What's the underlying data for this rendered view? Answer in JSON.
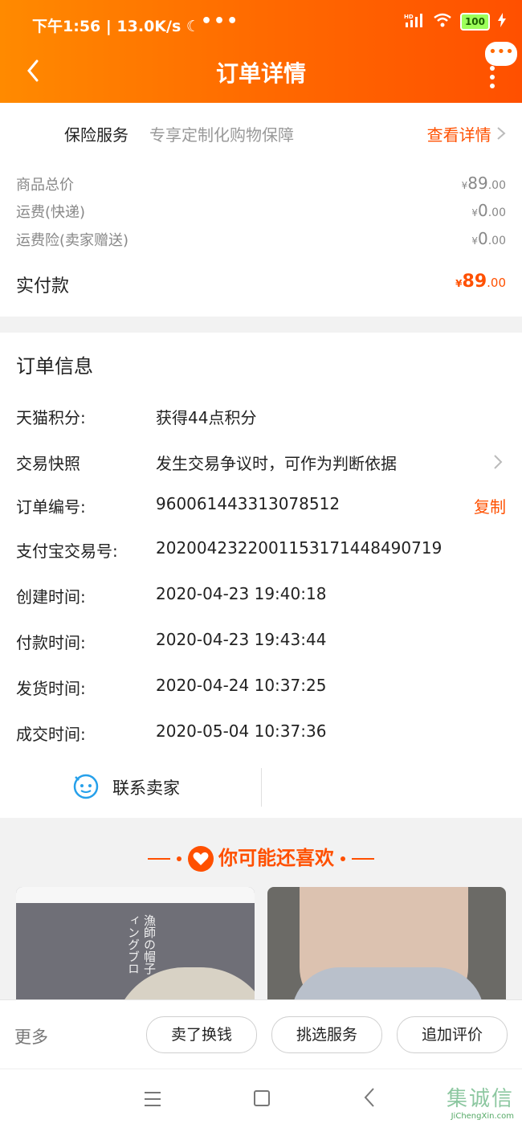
{
  "status_bar": {
    "time_speed": "下午1:56 | 13.0K/s",
    "moon": "☾",
    "dots": "•••",
    "net": "HD",
    "battery": "100"
  },
  "header": {
    "title": "订单详情",
    "bubble": "•••"
  },
  "insurance": {
    "title": "保险服务",
    "desc": "专享定制化购物保障",
    "link": "查看详情"
  },
  "prices": {
    "currency": "¥",
    "rows": [
      {
        "label": "商品总价",
        "int": "89",
        "dec": ".00"
      },
      {
        "label": "运费(快递)",
        "int": "0",
        "dec": ".00"
      },
      {
        "label": "运费险(卖家赠送)",
        "int": "0",
        "dec": ".00"
      }
    ],
    "paid_label": "实付款",
    "paid_int": "89",
    "paid_dec": ".00"
  },
  "order_info": {
    "title": "订单信息",
    "rows": [
      {
        "label": "天猫积分:",
        "value": "获得44点积分"
      },
      {
        "label": "交易快照",
        "value": "发生交易争议时，可作为判断依据"
      },
      {
        "label": "订单编号:",
        "value": "960061443313078512",
        "action": "复制"
      },
      {
        "label": "支付宝交易号:",
        "value": "2020042322001153171448490719"
      },
      {
        "label": "创建时间:",
        "value": "2020-04-23 19:40:18"
      },
      {
        "label": "付款时间:",
        "value": "2020-04-23 19:43:44"
      },
      {
        "label": "发货时间:",
        "value": "2020-04-24 10:37:25"
      },
      {
        "label": "成交时间:",
        "value": "2020-05-04 10:37:36"
      }
    ],
    "contact": "联系卖家"
  },
  "recommend": {
    "title": "你可能还喜欢",
    "thumb1_text": "漁師の帽子 サンディングブロ"
  },
  "bottom": {
    "more": "更多",
    "buttons": [
      "卖了换钱",
      "挑选服务",
      "追加评价"
    ]
  },
  "watermark": {
    "big": "集诚信",
    "small": "JiChengXin.com"
  },
  "colors": {
    "accent": "#ff5000",
    "header_start": "#ff8a00"
  }
}
